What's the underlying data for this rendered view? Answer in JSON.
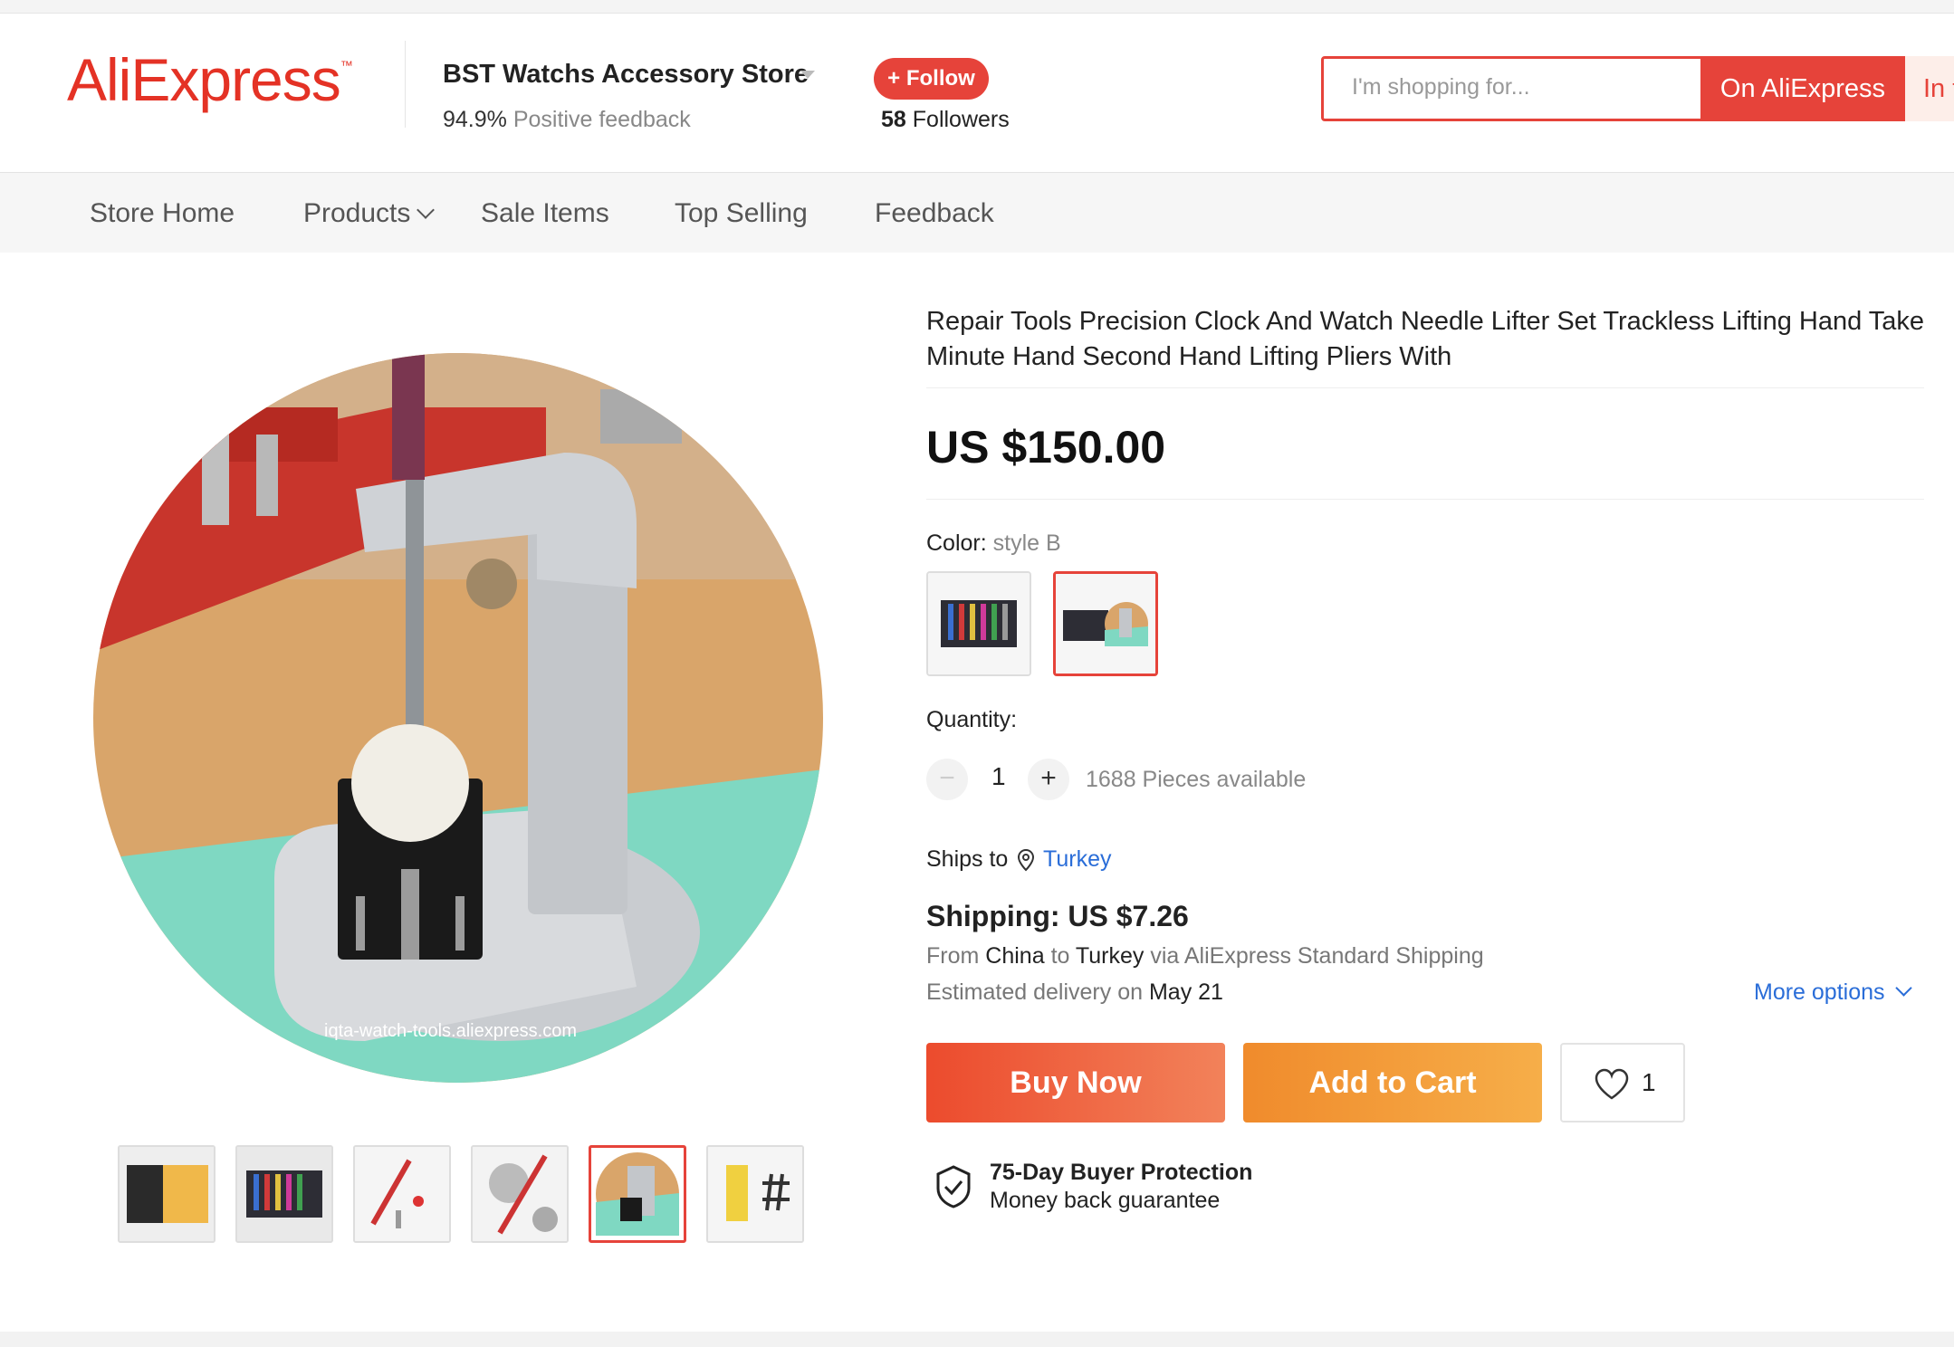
{
  "header": {
    "logo": "AliExpress",
    "logo_tm": "™",
    "store_name": "BST Watchs Accessory Store",
    "feedback_percent": "94.9%",
    "feedback_label": "Positive feedback",
    "follow_label": "+ Follow",
    "followers_count": "58",
    "followers_label": "Followers",
    "search_placeholder": "I'm shopping for...",
    "search_button": "On AliExpress",
    "search_button2": "In this store"
  },
  "nav": {
    "items": [
      "Store Home",
      "Products",
      "Sale Items",
      "Top Selling",
      "Feedback"
    ]
  },
  "gallery": {
    "watermark": "iqta-watch-tools.aliexpress.com",
    "thumbnail_count": 6,
    "selected_thumbnail": 5
  },
  "product": {
    "title": "Repair Tools Precision Clock And Watch Needle Lifter Set Trackless Lifting Hand Take Minute Hand Second Hand Lifting Pliers With",
    "price": "US $150.00",
    "color_label": "Color:",
    "color_value": "style B",
    "quantity_label": "Quantity:",
    "quantity": "1",
    "minus": "−",
    "plus": "+",
    "available": "1688 Pieces available",
    "ships_to_label": "Ships to",
    "ships_to_country": "Turkey",
    "shipping": "Shipping: US $7.26",
    "from_prefix": "From",
    "from_country": "China",
    "to_word": "to",
    "to_country": "Turkey",
    "via": "via AliExpress Standard Shipping",
    "est_prefix": "Estimated delivery on",
    "est_date": "May 21",
    "more_options": "More options",
    "buy_now": "Buy Now",
    "add_to_cart": "Add to Cart",
    "wishlist_count": "1",
    "protection_title": "75-Day Buyer Protection",
    "protection_sub": "Money back guarantee"
  },
  "colors": {
    "accent": "#e6433a",
    "link": "#2a6dd8",
    "buy_gradient": [
      "#ec4b2d",
      "#f2825a"
    ],
    "cart_gradient": [
      "#f08b2c",
      "#f6ae49"
    ]
  },
  "icons": [
    "chevron-down-icon",
    "location-pin-icon",
    "heart-icon",
    "shield-check-icon",
    "minus-icon",
    "plus-icon"
  ]
}
